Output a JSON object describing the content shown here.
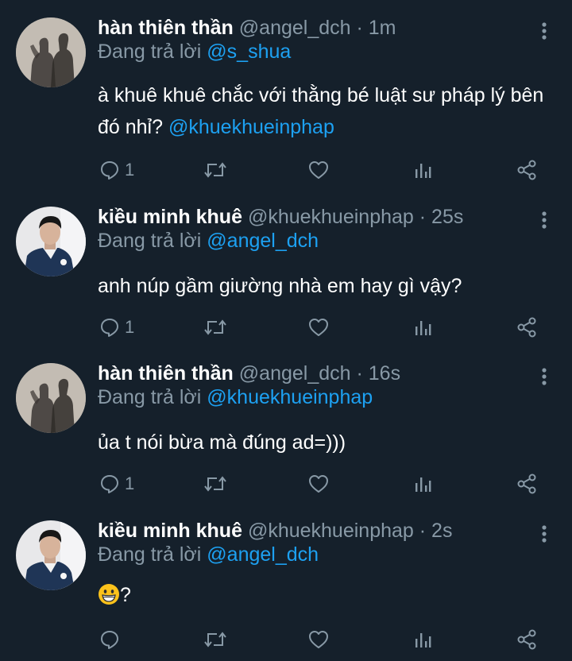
{
  "tweets": [
    {
      "name": "hàn thiên thần",
      "handle": "@angel_dch",
      "dot": "·",
      "time": "1m",
      "reply_prefix": "Đang trả lời",
      "reply_to": "@s_shua",
      "body_text": "à khuê khuê chắc với thằng bé luật sư pháp lý bên đó nhỉ?",
      "body_mention": "@khuekhueinphap",
      "reply_count": "1"
    },
    {
      "name": "kiều minh khuê",
      "handle": "@khuekhueinphap",
      "dot": "·",
      "time": "25s",
      "reply_prefix": "Đang trả lời",
      "reply_to": "@angel_dch",
      "body_text": "anh núp gầm giường nhà em hay gì vậy?",
      "reply_count": "1"
    },
    {
      "name": "hàn thiên thần",
      "handle": "@angel_dch",
      "dot": "·",
      "time": "16s",
      "reply_prefix": "Đang trả lời",
      "reply_to": "@khuekhueinphap",
      "body_text": "ủa t nói bừa mà đúng ad=)))",
      "reply_count": "1"
    },
    {
      "name": "kiều minh khuê",
      "handle": "@khuekhueinphap",
      "dot": "·",
      "time": "2s",
      "reply_prefix": "Đang trả lời",
      "reply_to": "@angel_dch",
      "body_text": "?",
      "emoji": "grinning-face",
      "reply_count": ""
    }
  ],
  "icons": {
    "reply": "comment-bubble-icon",
    "retweet": "retweet-arrows-icon",
    "like": "heart-icon",
    "analytics": "bar-chart-icon",
    "share": "share-nodes-icon",
    "more": "vertical-dots-icon"
  },
  "colors": {
    "background": "#15202b",
    "secondary_text": "#8899a6",
    "link": "#1da1f2"
  }
}
